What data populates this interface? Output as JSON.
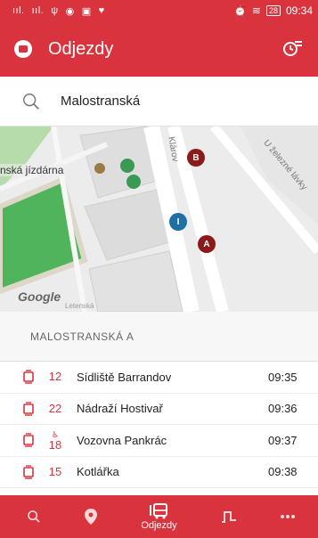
{
  "status_bar": {
    "signal_1": "ııl.",
    "signal_2": "ııl.",
    "battery": "28",
    "time": "09:34"
  },
  "app_bar": {
    "title": "Odjezdy"
  },
  "search": {
    "value": "Malostranská"
  },
  "map": {
    "place_label": "nská jízdárna",
    "street_label_1": "Klárov",
    "street_label_2": "U železné lávky",
    "small_label": "Letenská",
    "attribution": "Google",
    "markers": [
      "B",
      "I",
      "A"
    ],
    "accent_color": "#8b1a1a"
  },
  "stop": {
    "name": "MALOSTRANSKÁ A"
  },
  "departures": [
    {
      "line": "12",
      "accessible": "",
      "destination": "Sídliště Barrandov",
      "time": "09:35"
    },
    {
      "line": "22",
      "accessible": "",
      "destination": "Nádraží Hostivař",
      "time": "09:36"
    },
    {
      "line": "18",
      "accessible": "♿",
      "destination": "Vozovna Pankrác",
      "time": "09:37"
    },
    {
      "line": "15",
      "accessible": "",
      "destination": "Kotlářka",
      "time": "09:38"
    }
  ],
  "bottom_nav": {
    "active_label": "Odjezdy",
    "items": [
      "search-icon",
      "location-pin-icon",
      "bus-icon",
      "route-icon",
      "more-icon"
    ]
  },
  "colors": {
    "brand": "#d9333d",
    "line_number": "#d9333d"
  }
}
